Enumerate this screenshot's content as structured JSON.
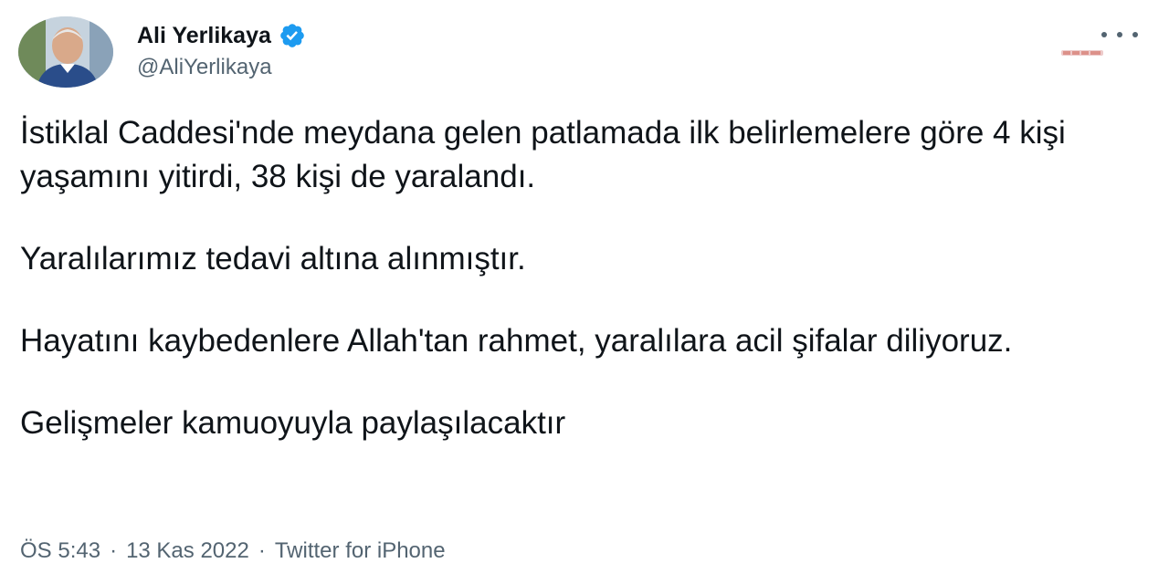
{
  "author": {
    "display_name": "Ali Yerlikaya",
    "handle": "@AliYerlikaya",
    "verified_icon": "verified-badge-icon",
    "avatar_icon": "profile-photo"
  },
  "tweet": {
    "paragraphs": [
      "İstiklal Caddesi'nde meydana gelen patlamada ilk belirlemelere göre 4 kişi yaşamını yitirdi, 38 kişi de yaralandı.",
      "Yaralılarımız tedavi altına alınmıştır.",
      "Hayatını kaybedenlere Allah'tan rahmet, yaralılara acil şifalar diliyoruz.",
      "Gelişmeler kamuoyuyla paylaşılacaktır"
    ],
    "time": "ÖS 5:43",
    "separator": "·",
    "date": "13 Kas 2022",
    "source": "Twitter for iPhone"
  },
  "more_icon": "more-options-icon",
  "colors": {
    "text": "#0f1419",
    "secondary": "#536471",
    "verified": "#1d9bf0"
  }
}
